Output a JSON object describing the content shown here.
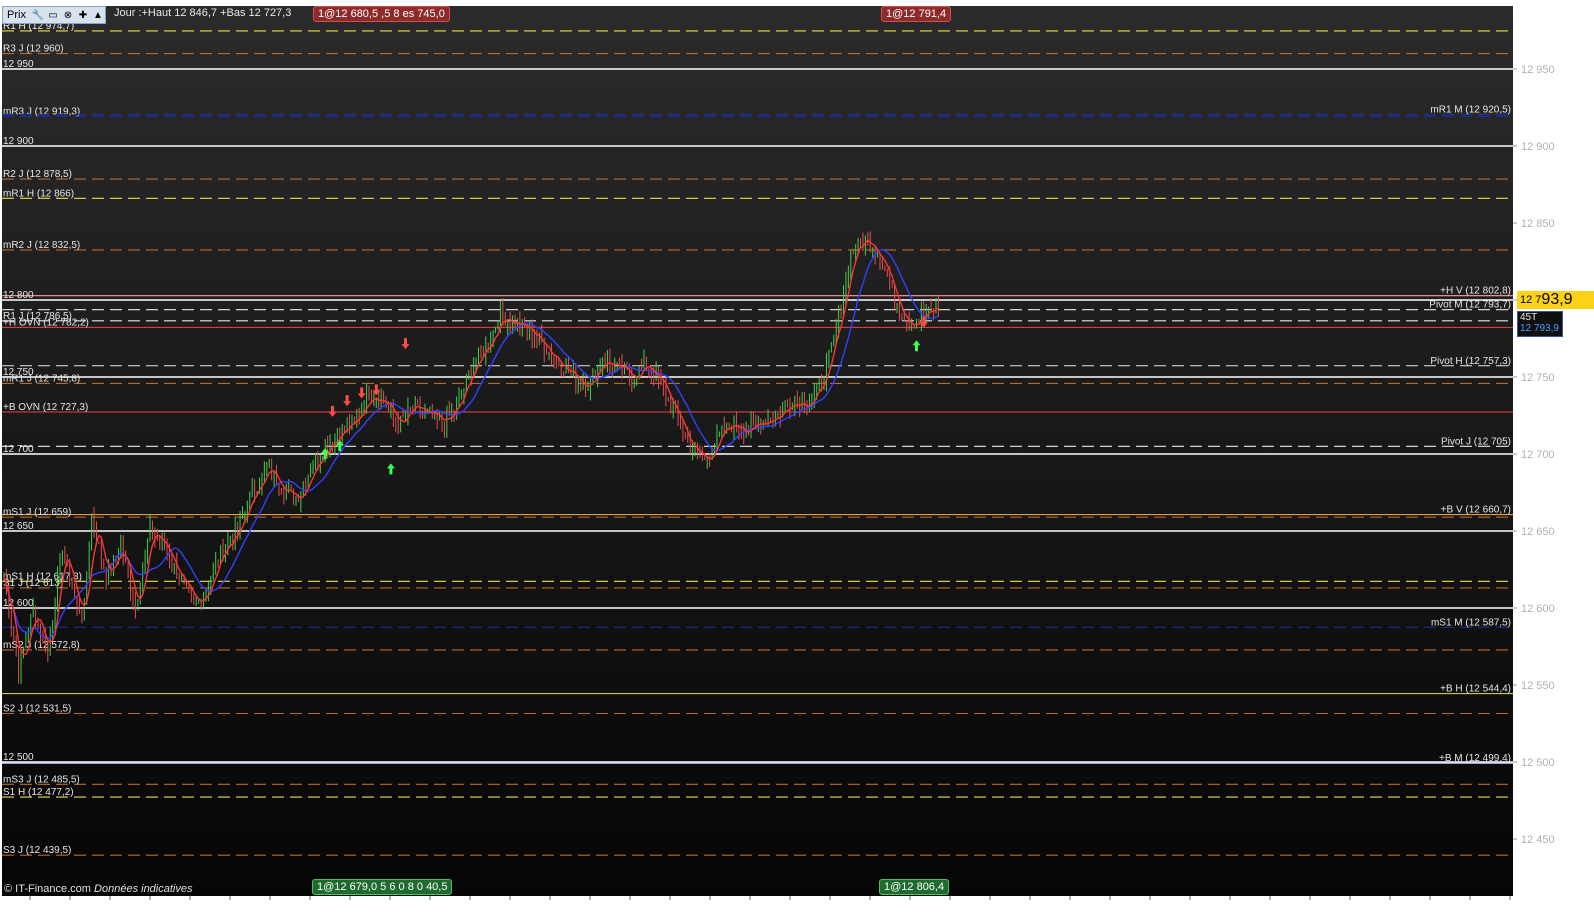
{
  "toolbar": {
    "prix_label": "Prix",
    "icons": [
      "wrench-icon",
      "window-icon",
      "close-icon",
      "add-icon",
      "up-arrow-icon"
    ],
    "info": "Jour :+Haut 12 846,7 +Bas 12 727,3"
  },
  "tags": {
    "top_left": "1@12 680,5",
    "top_left_tail": ",5",
    "top_left_tail2": "8",
    "top_left_tail3": "es 745,0",
    "top_right": "1@12 791,4",
    "bottom_left": "1@12 679,0",
    "bottom_left_tail": "5",
    "bottom_left_tail2": "6 0 8 0",
    "bottom_left_tail3": "40,5",
    "bottom_right": "1@12 806,4"
  },
  "credit": {
    "source": "© IT-Finance.com",
    "note": "Données indicatives"
  },
  "price_marker": {
    "small": "12 7",
    "big": "93,9"
  },
  "time_marker": {
    "line1": "45T",
    "line2": "12 793,9"
  },
  "colors": {
    "background_top": "#2b2b2b",
    "background_bottom": "#050505",
    "candle_up": "#3bd14a",
    "candle_down": "#e05050",
    "ma_fast": "#ff3333",
    "ma_slow": "#3040ff",
    "price_marker": "#ffd21a"
  },
  "chart_data": {
    "type": "candlestick",
    "ylim": [
      12420,
      13000
    ],
    "yticks": [
      12450,
      12500,
      12550,
      12600,
      12650,
      12700,
      12750,
      12800,
      12850,
      12900,
      12950
    ],
    "ytick_labels": [
      "12 450",
      "12 500",
      "12 550",
      "12 600",
      "12 650",
      "12 700",
      "12 750",
      "12 800",
      "12 850",
      "12 900",
      "12 950"
    ],
    "price_path": [
      [
        0,
        12620
      ],
      [
        1,
        12560
      ],
      [
        2,
        12600
      ],
      [
        3,
        12570
      ],
      [
        4,
        12640
      ],
      [
        5,
        12600
      ],
      [
        5.5,
        12600
      ],
      [
        6,
        12660
      ],
      [
        7,
        12620
      ],
      [
        8,
        12640
      ],
      [
        9,
        12600
      ],
      [
        10,
        12650
      ],
      [
        11,
        12640
      ],
      [
        12,
        12620
      ],
      [
        13,
        12600
      ],
      [
        14,
        12615
      ],
      [
        15,
        12640
      ],
      [
        16,
        12650
      ],
      [
        17,
        12675
      ],
      [
        18,
        12690
      ],
      [
        19,
        12680
      ],
      [
        20,
        12670
      ],
      [
        21,
        12690
      ],
      [
        22,
        12705
      ],
      [
        23,
        12715
      ],
      [
        24,
        12720
      ],
      [
        25,
        12740
      ],
      [
        26,
        12735
      ],
      [
        27,
        12718
      ],
      [
        28,
        12730
      ],
      [
        29,
        12725
      ],
      [
        30,
        12720
      ],
      [
        31,
        12730
      ],
      [
        32,
        12755
      ],
      [
        33,
        12770
      ],
      [
        34,
        12790
      ],
      [
        35,
        12785
      ],
      [
        36,
        12780
      ],
      [
        37,
        12770
      ],
      [
        38,
        12760
      ],
      [
        39,
        12750
      ],
      [
        40,
        12745
      ],
      [
        41,
        12762
      ],
      [
        42,
        12755
      ],
      [
        43,
        12750
      ],
      [
        44,
        12758
      ],
      [
        45,
        12745
      ],
      [
        46,
        12725
      ],
      [
        47,
        12705
      ],
      [
        48,
        12695
      ],
      [
        49,
        12712
      ],
      [
        50,
        12720
      ],
      [
        51,
        12715
      ],
      [
        52,
        12722
      ],
      [
        53,
        12725
      ],
      [
        54,
        12735
      ],
      [
        55,
        12733
      ],
      [
        56,
        12745
      ],
      [
        57,
        12780
      ],
      [
        58,
        12830
      ],
      [
        59,
        12840
      ],
      [
        60,
        12830
      ],
      [
        61,
        12800
      ],
      [
        62,
        12785
      ],
      [
        63,
        12790
      ],
      [
        64,
        12795
      ]
    ],
    "levels": [
      {
        "label": "R1 H (12 974,7)",
        "value": 12974.7,
        "side": "left",
        "color": "#e8e040",
        "style": "dash"
      },
      {
        "label": "R3 J (12 960)",
        "value": 12960,
        "side": "left",
        "color": "#b86a2a",
        "style": "dash"
      },
      {
        "label": "12 950",
        "value": 12950,
        "side": "left",
        "color": "#ffffff",
        "style": "solid"
      },
      {
        "label": "mR3 J (12 919,3)",
        "value": 12919.3,
        "side": "left",
        "color": "#2030a0",
        "style": "dash"
      },
      {
        "label": "mR1 M (12 920,5)",
        "value": 12920.5,
        "side": "right",
        "color": "#2030a0",
        "style": "dash"
      },
      {
        "label": "12 900",
        "value": 12900,
        "side": "left",
        "color": "#ffffff",
        "style": "solid"
      },
      {
        "label": "R2 J (12 878,5)",
        "value": 12878.5,
        "side": "left",
        "color": "#b86a2a",
        "style": "dash"
      },
      {
        "label": "mR1 H (12 866)",
        "value": 12866,
        "side": "left",
        "color": "#e8e040",
        "style": "dash"
      },
      {
        "label": "mR2 J (12 832,5)",
        "value": 12832.5,
        "side": "left",
        "color": "#b86a2a",
        "style": "dash"
      },
      {
        "label": "+H V (12 802,8)",
        "value": 12802.8,
        "side": "right",
        "color": "#ff9e9e",
        "style": "solid"
      },
      {
        "label": "12 800",
        "value": 12800,
        "side": "left",
        "color": "#ffffff",
        "style": "solid"
      },
      {
        "label": "Pivot M (12 793,7)",
        "value": 12793.7,
        "side": "right",
        "color": "#e8e8e8",
        "style": "dash"
      },
      {
        "label": "R1 J (12 786,5)",
        "value": 12786.5,
        "side": "left",
        "color": "#e8e8e8",
        "style": "dash"
      },
      {
        "label": "+H OVN (12 782,2)",
        "value": 12782.2,
        "side": "left",
        "color": "#d04040",
        "style": "solid"
      },
      {
        "label": "Pivot H (12 757,3)",
        "value": 12757.3,
        "side": "right",
        "color": "#e8e8e8",
        "style": "dash"
      },
      {
        "label": "12 750",
        "value": 12750,
        "side": "left",
        "color": "#ffffff",
        "style": "solid"
      },
      {
        "label": "mR1 J (12 745,8)",
        "value": 12745.8,
        "side": "left",
        "color": "#b86a2a",
        "style": "dash"
      },
      {
        "label": "+B OVN (12 727,3)",
        "value": 12727.3,
        "side": "left",
        "color": "#d04040",
        "style": "solid"
      },
      {
        "label": "Pivot J (12 705)",
        "value": 12705,
        "side": "right",
        "color": "#e8e8e8",
        "style": "dash"
      },
      {
        "label": "12 700",
        "value": 12700,
        "side": "left",
        "color": "#ffffff",
        "style": "solid"
      },
      {
        "label": "+B V (12 660,7)",
        "value": 12660.7,
        "side": "right",
        "color": "#e0a050",
        "style": "solid"
      },
      {
        "label": "mS1 J (12 659)",
        "value": 12659,
        "side": "left",
        "color": "#b86a2a",
        "style": "dash"
      },
      {
        "label": "12 650",
        "value": 12650,
        "side": "left",
        "color": "#ffffff",
        "style": "solid"
      },
      {
        "label": "mS1 H (12 617,3)",
        "value": 12617.3,
        "side": "left",
        "color": "#e8e040",
        "style": "dash"
      },
      {
        "label": "S1 J (12 613)",
        "value": 12613,
        "side": "left",
        "color": "#b86a2a",
        "style": "dash"
      },
      {
        "label": "12 600",
        "value": 12600,
        "side": "left",
        "color": "#ffffff",
        "style": "solid"
      },
      {
        "label": "mS1 M (12 587,5)",
        "value": 12587.5,
        "side": "right",
        "color": "#2030a0",
        "style": "dash"
      },
      {
        "label": "mS2 J (12 572,8)",
        "value": 12572.8,
        "side": "left",
        "color": "#b86a2a",
        "style": "dash"
      },
      {
        "label": "+B H (12 544,4)",
        "value": 12544.4,
        "side": "right",
        "color": "#e8e040",
        "style": "solid"
      },
      {
        "label": "S2 J (12 531,5)",
        "value": 12531.5,
        "side": "left",
        "color": "#b86a2a",
        "style": "dash"
      },
      {
        "label": "12 500",
        "value": 12500,
        "side": "left",
        "color": "#ffffff",
        "style": "solid"
      },
      {
        "label": "+B M (12 499,4)",
        "value": 12499.4,
        "side": "right",
        "color": "#d8d8ff",
        "style": "solid"
      },
      {
        "label": "mS3 J (12 485,5)",
        "value": 12485.5,
        "side": "left",
        "color": "#b86a2a",
        "style": "dash"
      },
      {
        "label": "S1 H (12 477,2)",
        "value": 12477.2,
        "side": "left",
        "color": "#e8e040",
        "style": "dash"
      },
      {
        "label": "S3 J (12 439,5)",
        "value": 12439.5,
        "side": "left",
        "color": "#b86a2a",
        "style": "dash"
      }
    ],
    "signals": [
      {
        "x": 22,
        "price": 12700,
        "kind": "up"
      },
      {
        "x": 23,
        "price": 12705,
        "kind": "up"
      },
      {
        "x": 22.5,
        "price": 12728,
        "kind": "down"
      },
      {
        "x": 23.5,
        "price": 12735,
        "kind": "down"
      },
      {
        "x": 24.5,
        "price": 12740,
        "kind": "down"
      },
      {
        "x": 25.5,
        "price": 12742,
        "kind": "down"
      },
      {
        "x": 26.5,
        "price": 12690,
        "kind": "up"
      },
      {
        "x": 27.5,
        "price": 12772,
        "kind": "down"
      },
      {
        "x": 62.5,
        "price": 12770,
        "kind": "up"
      },
      {
        "x": 63,
        "price": 12786,
        "kind": "down"
      }
    ]
  }
}
